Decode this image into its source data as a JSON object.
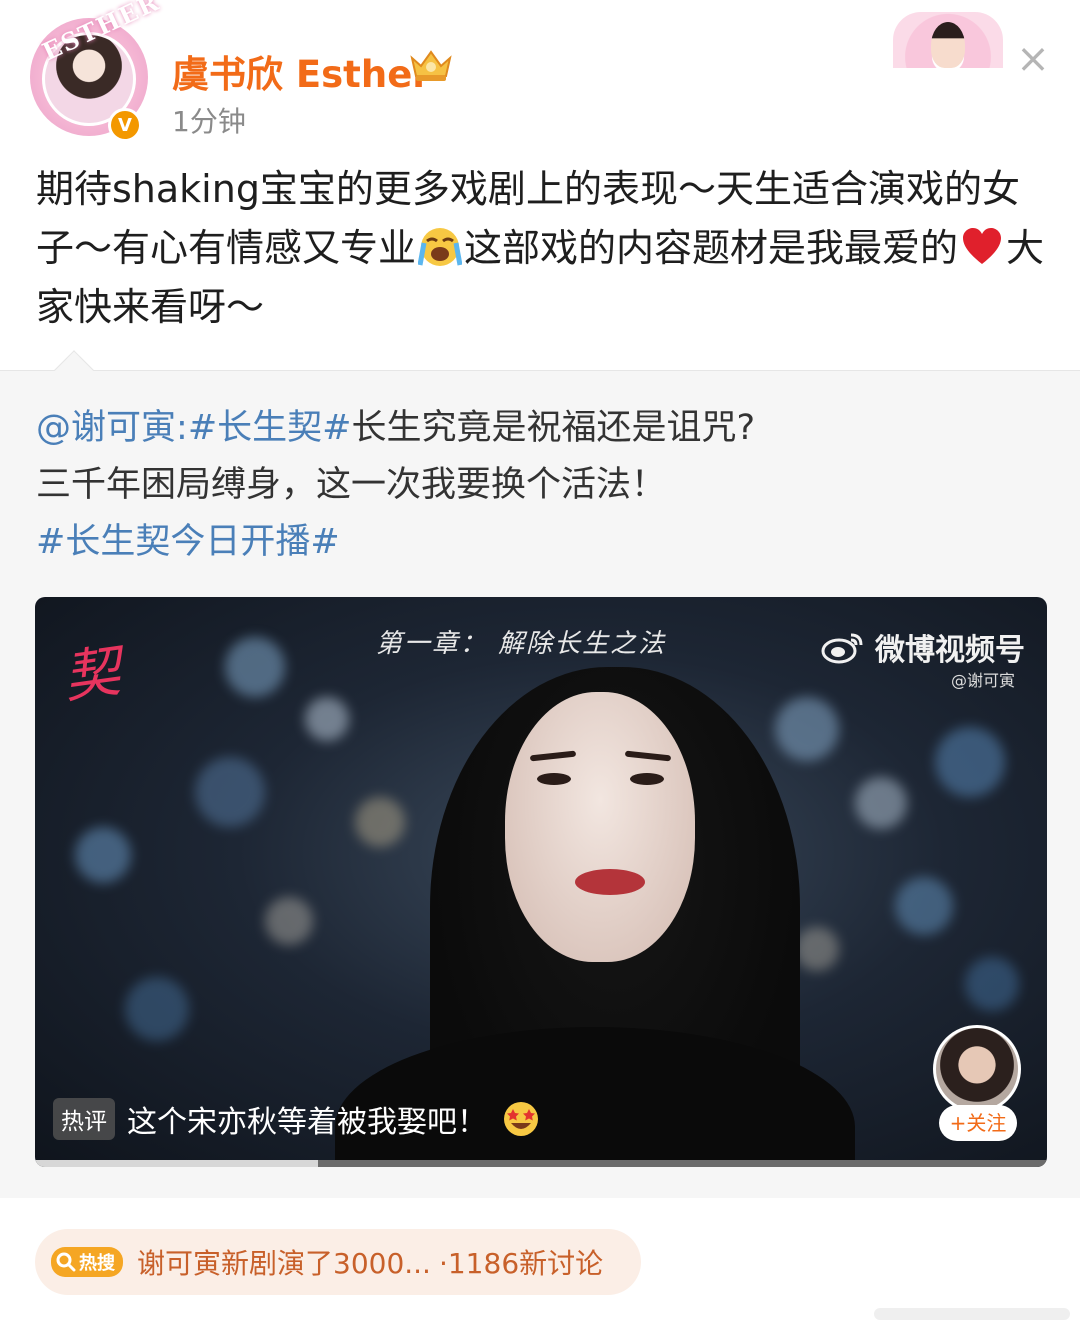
{
  "post": {
    "user_name": "虞书欣 Esther",
    "avatar_deco_text": "ESTHER",
    "verified_mark": "V",
    "time": "1分钟",
    "text_part1": "期待shaking宝宝的更多戏剧上的表现～天生适合演戏的女子～有心有情感又专业",
    "text_part2": "这部戏的内容题材是我最爱的",
    "text_part3": "大家快来看呀～",
    "close_symbol": "×"
  },
  "repost": {
    "mention": "@谢可寅",
    "colon": ":",
    "topic1": "#长生契#",
    "line1_rest": "长生究竟是祝福还是诅咒?",
    "line2": "三千年困局缚身，这一次我要换个活法！",
    "topic2": "#长生契今日开播#"
  },
  "video": {
    "chapter_title": "第一章： 解除长生之法",
    "platform_label": "微博视频号",
    "handle": "@谢可寅",
    "hot_tag": "热评",
    "hot_comment": "这个宋亦秋等着被我娶吧！",
    "follow_label": "+关注",
    "progress": 0.28
  },
  "hot_search": {
    "badge": "热搜",
    "text": "谢可寅新剧演了3000...",
    "count": "·1186新讨论"
  },
  "colors": {
    "username": "#f26b18",
    "link": "#4a7fb8",
    "hot_search_text": "#c8602a",
    "hot_search_bg": "#fbeee6",
    "verified": "#f39800"
  },
  "icons": [
    "crown-vip-icon",
    "verified-icon",
    "close-icon",
    "loudly-crying-emoji",
    "red-heart-emoji",
    "weibo-eye-icon",
    "star-struck-emoji",
    "search-icon"
  ]
}
